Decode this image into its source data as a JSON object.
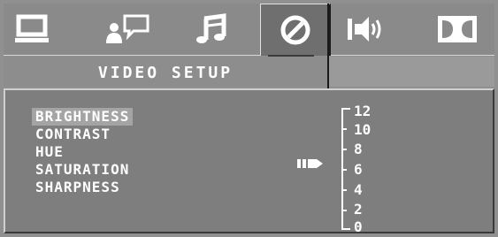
{
  "tabs": [
    {
      "icon": "monitor-icon",
      "active": false
    },
    {
      "icon": "language-icon",
      "active": false
    },
    {
      "icon": "audio-note-icon",
      "active": false
    },
    {
      "icon": "video-disc-icon",
      "active": true
    },
    {
      "icon": "speaker-icon",
      "active": false
    },
    {
      "icon": "dolby-icon",
      "active": false
    }
  ],
  "page_title": "VIDEO SETUP",
  "menu": {
    "items": [
      {
        "label": "BRIGHTNESS",
        "selected": true
      },
      {
        "label": "CONTRAST",
        "selected": false
      },
      {
        "label": "HUE",
        "selected": false
      },
      {
        "label": "SATURATION",
        "selected": false
      },
      {
        "label": "SHARPNESS",
        "selected": false
      }
    ]
  },
  "scale": {
    "labels": [
      "12",
      "10",
      "8",
      "6",
      "4",
      "2",
      "0"
    ],
    "current_value": 6,
    "pointer_icon": "arrow-pointer-icon"
  },
  "colors": {
    "background": "#909090",
    "panel": "#7e7e7e",
    "selected_row": "#a4a4a4",
    "text": "#ffffff"
  }
}
